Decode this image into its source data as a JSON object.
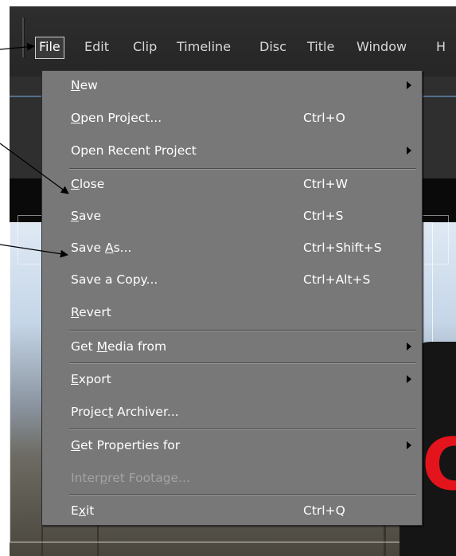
{
  "menubar": {
    "items": [
      {
        "label": "File",
        "active": true
      },
      {
        "label": "Edit"
      },
      {
        "label": "Clip"
      },
      {
        "label": "Timeline"
      },
      {
        "label": "Disc"
      },
      {
        "label": "Title"
      },
      {
        "label": "Window"
      },
      {
        "label": "H"
      }
    ]
  },
  "file_menu": {
    "items": [
      {
        "label": "New",
        "mnemonic": "N",
        "shortcut": "",
        "submenu": true
      },
      {
        "label": "Open Project...",
        "mnemonic": "O",
        "shortcut": "Ctrl+O",
        "submenu": false
      },
      {
        "label": "Open Recent Project",
        "mnemonic": "",
        "shortcut": "",
        "submenu": true
      },
      {
        "label": "Close",
        "mnemonic": "C",
        "shortcut": "Ctrl+W",
        "submenu": false
      },
      {
        "label": "Save",
        "mnemonic": "S",
        "shortcut": "Ctrl+S",
        "submenu": false
      },
      {
        "label": "Save As...",
        "mnemonic": "A",
        "shortcut": "Ctrl+Shift+S",
        "submenu": false
      },
      {
        "label": "Save a Copy...",
        "mnemonic": "y",
        "shortcut": "Ctrl+Alt+S",
        "submenu": false
      },
      {
        "label": "Revert",
        "mnemonic": "R",
        "shortcut": "",
        "submenu": false
      },
      {
        "label": "Get Media from",
        "mnemonic": "M",
        "shortcut": "",
        "submenu": true
      },
      {
        "label": "Export",
        "mnemonic": "E",
        "shortcut": "",
        "submenu": true
      },
      {
        "label": "Project Archiver...",
        "mnemonic": "t",
        "shortcut": "",
        "submenu": false
      },
      {
        "label": "Get Properties for",
        "mnemonic": "G",
        "shortcut": "",
        "submenu": true
      },
      {
        "label": "Interpret Footage...",
        "mnemonic": "p",
        "shortcut": "",
        "submenu": false,
        "disabled": true
      },
      {
        "label": "Exit",
        "mnemonic": "x",
        "shortcut": "Ctrl+Q",
        "submenu": false
      }
    ]
  },
  "preview": {
    "overlay_glyph": "C",
    "accent_color": "#e3141b"
  },
  "colors": {
    "menu_background": "#787878",
    "menubar_background": "#2b2b2b"
  }
}
